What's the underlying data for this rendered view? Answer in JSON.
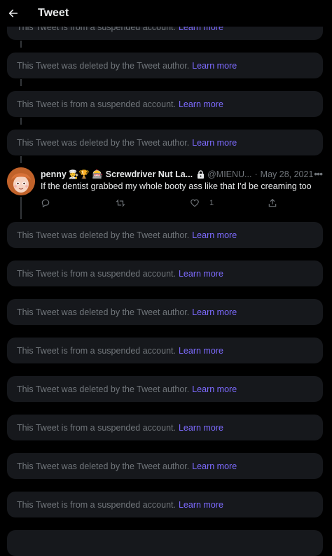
{
  "header": {
    "title": "Tweet",
    "back_icon": "arrow-left-icon"
  },
  "notices": {
    "deleted_text": "This Tweet was deleted by the Tweet author.",
    "suspended_text": "This Tweet is from a suspended account.",
    "learn_more": "Learn more",
    "items_above": [
      "suspended",
      "deleted",
      "suspended",
      "deleted"
    ],
    "items_below": [
      "deleted",
      "suspended",
      "deleted",
      "suspended",
      "deleted",
      "suspended",
      "deleted",
      "suspended"
    ]
  },
  "tweet": {
    "display_name": "penny",
    "name_emojis": "👨‍🍳🏆",
    "name_suffix": "🎰 Screwdriver Nut La...",
    "handle": "@MIENU...",
    "separator": "·",
    "date": "May 28, 2021",
    "text": "If the dentist grabbed my whole booty ass like that I'd be creaming too",
    "like_count": "1",
    "more_icon": "more-horizontal-icon"
  },
  "colors": {
    "background": "#000000",
    "card": "#16181c",
    "muted_text": "#71767b",
    "link": "#7d6bff",
    "primary_text": "#e7e9ea"
  }
}
